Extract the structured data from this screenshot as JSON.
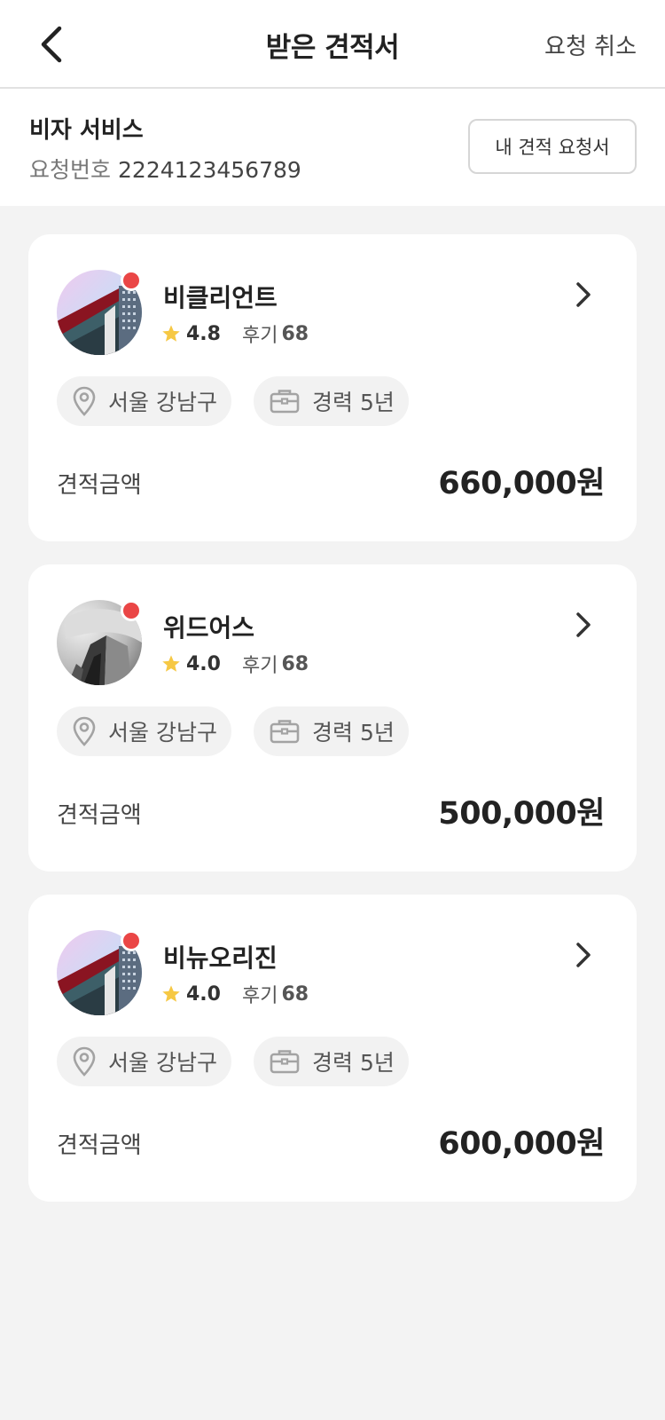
{
  "header": {
    "title": "받은 견적서",
    "cancel_label": "요청 취소",
    "back_icon": "chevron-left-icon"
  },
  "request_info": {
    "service_name": "비자 서비스",
    "request_number_label": "요청번호",
    "request_number": "2224123456789",
    "my_request_button": "내 견적 요청서"
  },
  "colors": {
    "new_badge": "#ea4646",
    "star": "#f6c844",
    "background": "#f3f3f3"
  },
  "quotes": [
    {
      "company": "비클리언트",
      "rating": "4.8",
      "review_label": "후기",
      "review_count": "68",
      "location": "서울 강남구",
      "career": "경력 5년",
      "price_label": "견적금액",
      "price": "660,000원",
      "has_new_badge": true
    },
    {
      "company": "위드어스",
      "rating": "4.0",
      "review_label": "후기",
      "review_count": "68",
      "location": "서울 강남구",
      "career": "경력 5년",
      "price_label": "견적금액",
      "price": "500,000원",
      "has_new_badge": true
    },
    {
      "company": "비뉴오리진",
      "rating": "4.0",
      "review_label": "후기",
      "review_count": "68",
      "location": "서울 강남구",
      "career": "경력 5년",
      "price_label": "견적금액",
      "price": "600,000원",
      "has_new_badge": true
    }
  ]
}
